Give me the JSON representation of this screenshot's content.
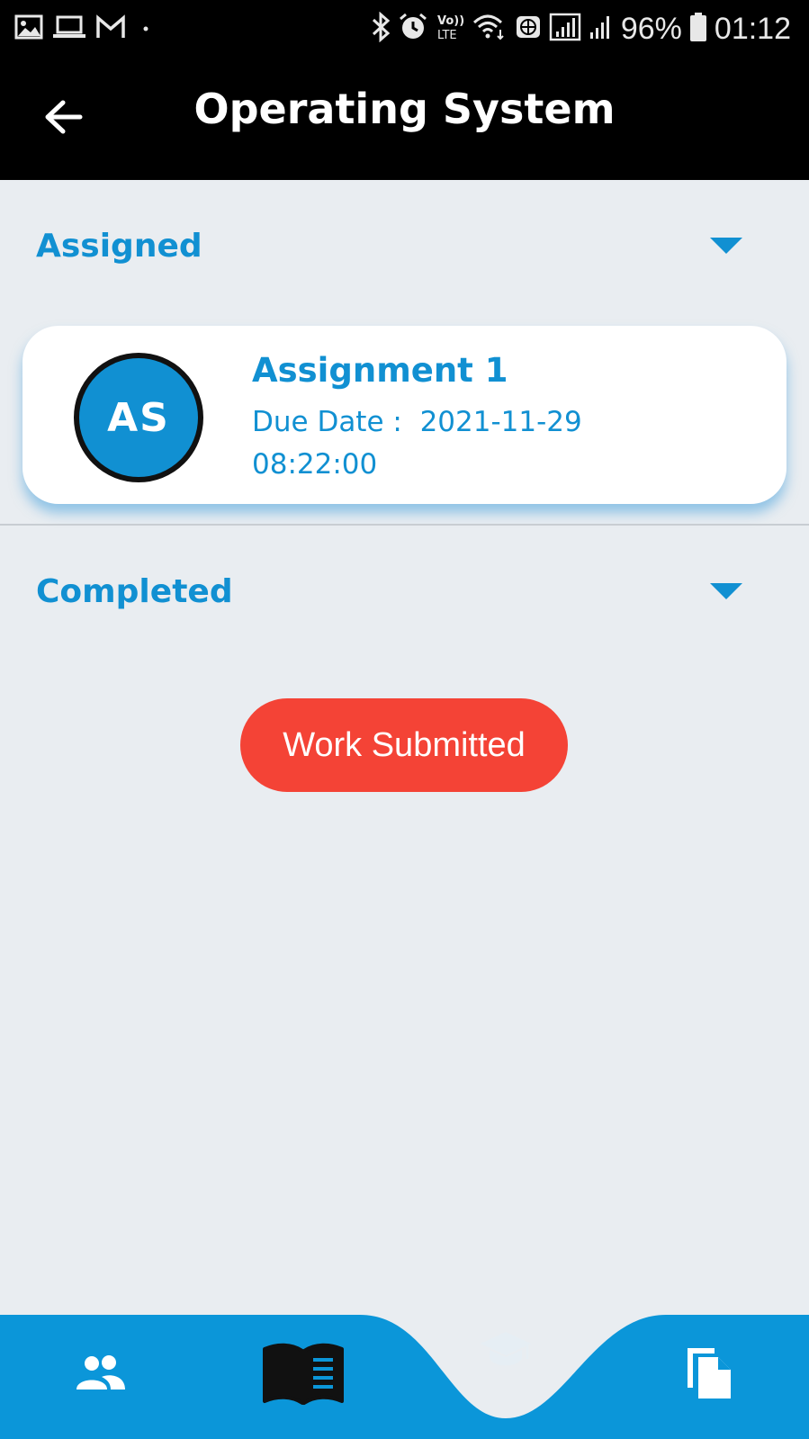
{
  "status_bar": {
    "battery": "96%",
    "time": "01:12",
    "left_icons": [
      "image-icon",
      "laptop-icon",
      "gmail-icon",
      "dot-icon"
    ],
    "right_icons": [
      "bluetooth-icon",
      "alarm-icon",
      "volte-icon",
      "wifi-icon",
      "vpn-icon",
      "signal-icon",
      "signal-icon",
      "battery-icon"
    ]
  },
  "app_bar": {
    "title": "Operating System",
    "back_icon": "arrow-left-icon"
  },
  "sections": {
    "assigned": {
      "title": "Assigned",
      "icon": "caret-down-icon"
    },
    "completed": {
      "title": "Completed",
      "icon": "caret-down-icon"
    }
  },
  "assignment_card": {
    "avatar_initials": "AS",
    "title": "Assignment 1",
    "due_label": "Due Date :",
    "due_value": "2021-11-29 08:22:00"
  },
  "completed_status": {
    "label": "Work Submitted",
    "color": "#f44336"
  },
  "bottom_nav": {
    "background_color": "#0b96d9",
    "items": [
      {
        "icon": "people-icon",
        "active": false
      },
      {
        "icon": "book-icon",
        "active": true
      },
      {
        "icon": "graduation-cap-icon",
        "active": false
      },
      {
        "icon": "documents-icon",
        "active": false
      }
    ]
  },
  "colors": {
    "accent": "#1190d2",
    "background": "#e9edf1",
    "header": "#000000"
  }
}
